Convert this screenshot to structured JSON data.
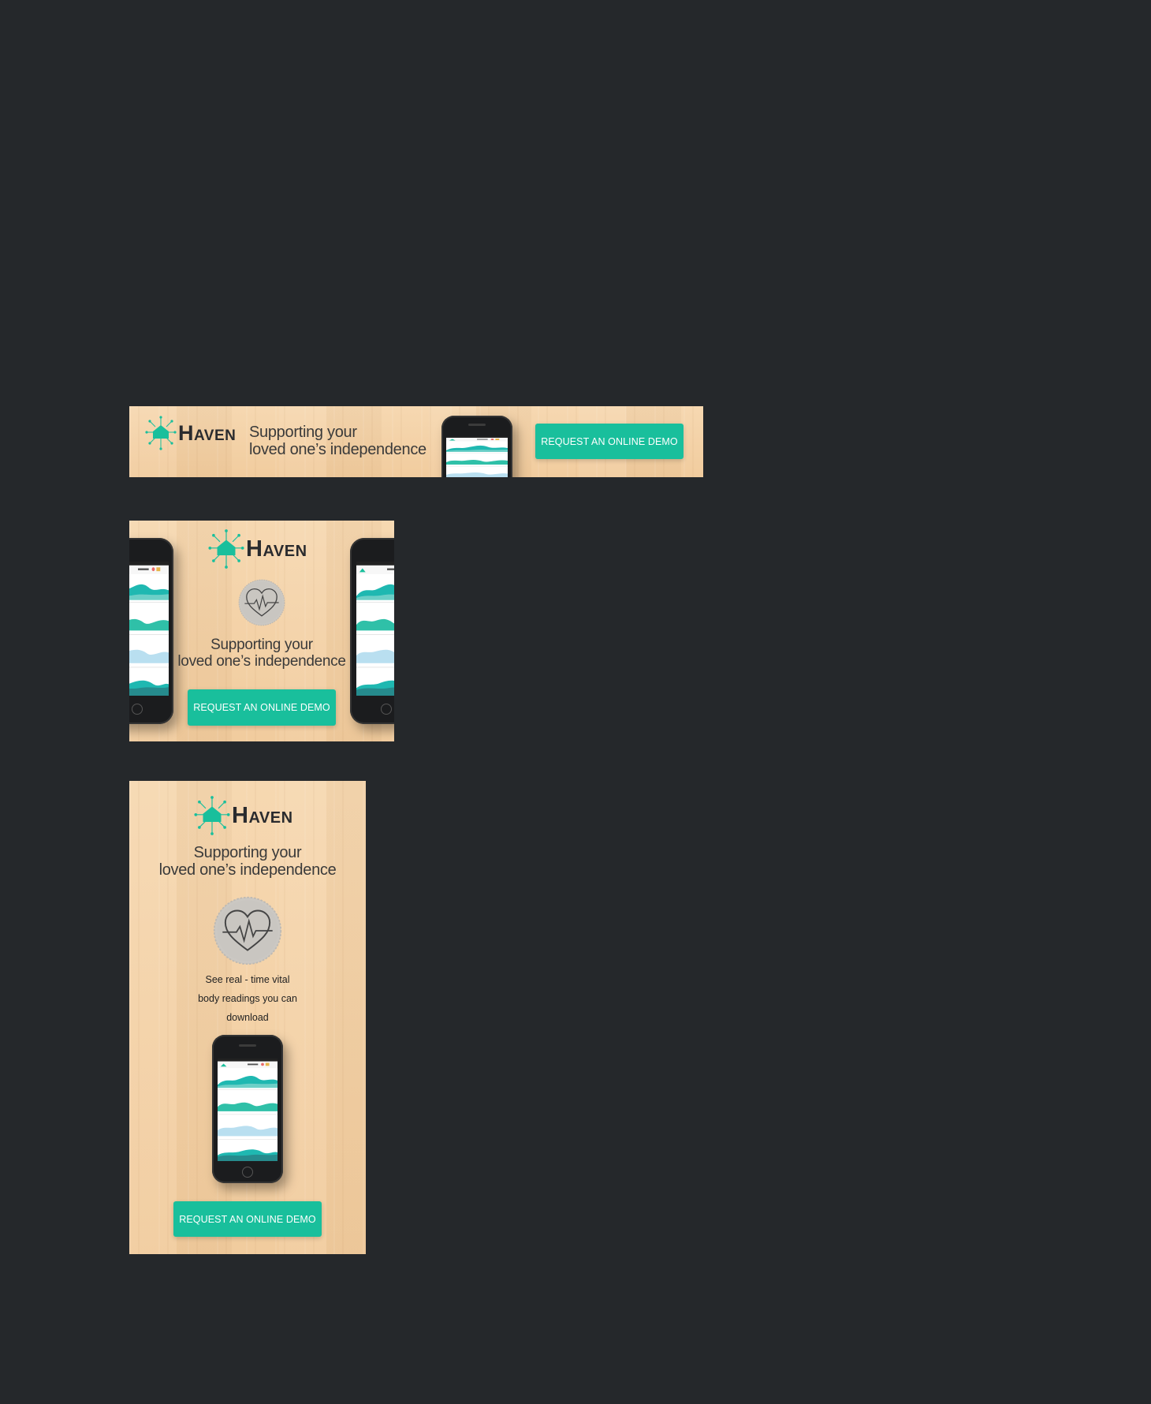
{
  "brand": {
    "name": "Haven",
    "accent": "#19bf9c",
    "ink": "#2a2b2e"
  },
  "tagline": {
    "line1": "Supporting your",
    "line2": "loved one’s independence"
  },
  "cta": {
    "label": "REQUEST AN ONLINE DEMO"
  },
  "vital_text": {
    "line1": "See real - time vital",
    "line2": "body readings you can",
    "line3": "download"
  },
  "phone_screen": {
    "status_carrier": "CARRIER",
    "user_name": "Mary Clark"
  },
  "icons": [
    "haven-logo-icon",
    "heart-pulse-icon",
    "phone-mockup"
  ]
}
